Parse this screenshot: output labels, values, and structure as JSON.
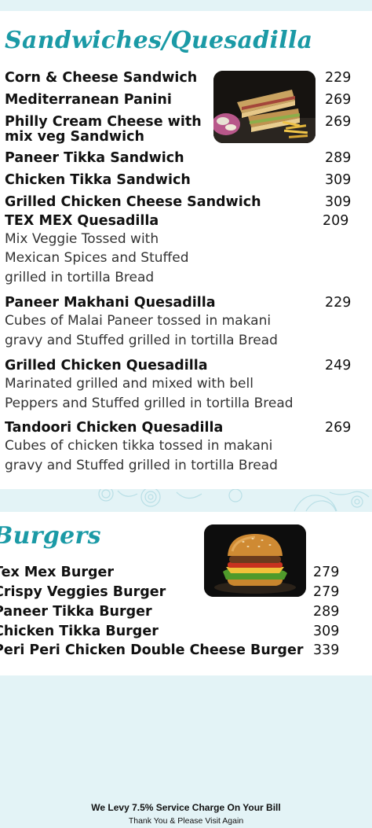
{
  "sandwiches": {
    "title": "Sandwiches/Quesadilla",
    "items": [
      {
        "name": "Corn & Cheese Sandwich",
        "price": "229"
      },
      {
        "name": "Mediterranean Panini",
        "price": "269"
      },
      {
        "name": "Philly Cream Cheese with",
        "name2": "mix veg Sandwich",
        "price": "269"
      },
      {
        "name": "Paneer Tikka Sandwich",
        "price": "289"
      },
      {
        "name": "Chicken Tikka Sandwich",
        "price": "309"
      },
      {
        "name": "Grilled Chicken Cheese Sandwich",
        "price": "309"
      },
      {
        "name": "TEX MEX Quesadilla",
        "price": "209",
        "desc": [
          "Mix Veggie Tossed with",
          "Mexican Spices and Stuffed",
          "grilled in tortilla Bread"
        ]
      },
      {
        "name": "Paneer Makhani Quesadilla",
        "price": "229",
        "desc": [
          "Cubes of Malai Paneer tossed in makani",
          "gravy and Stuffed grilled in tortilla Bread"
        ]
      },
      {
        "name": "Grilled Chicken Quesadilla",
        "price": "249",
        "desc": [
          "Marinated grilled and mixed with bell",
          "Peppers and Stuffed grilled in tortilla Bread"
        ]
      },
      {
        "name": "Tandoori Chicken Quesadilla",
        "price": "269",
        "desc": [
          "Cubes of chicken tikka tossed in makani",
          "gravy and Stuffed grilled in tortilla Bread"
        ]
      }
    ]
  },
  "burgers": {
    "title": "Burgers",
    "items": [
      {
        "name": "Tex Mex Burger",
        "price": "279"
      },
      {
        "name": "Crispy Veggies Burger",
        "price": "279"
      },
      {
        "name": "Paneer Tikka Burger",
        "price": "289"
      },
      {
        "name": "Chicken Tikka Burger",
        "price": "309"
      },
      {
        "name": "Peri Peri Chicken Double Cheese Burger",
        "price": "339"
      }
    ]
  },
  "footer": {
    "service_charge": "We Levy 7.5% Service Charge On Your Bill",
    "thanks": "Thank You & Please Visit Again"
  },
  "colors": {
    "accent": "#1b9aa6",
    "background": "#e3f3f6",
    "panel": "#ffffff"
  },
  "icons": [
    "sandwich-photo",
    "burger-photo",
    "swirl-decoration"
  ]
}
